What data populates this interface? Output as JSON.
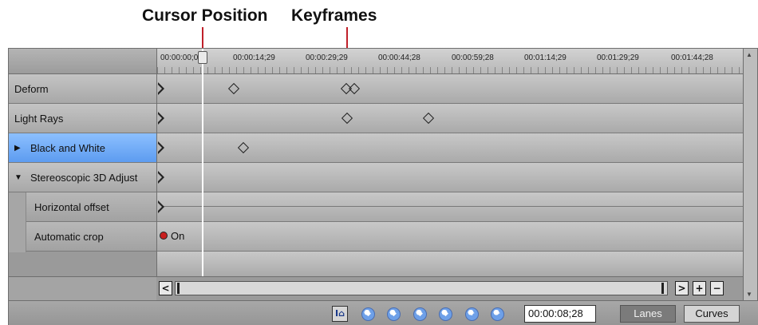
{
  "annotations": {
    "cursor_position": "Cursor Position",
    "keyframes": "Keyframes"
  },
  "ruler": {
    "labels": [
      "00:00:00;00",
      "00:00:14;29",
      "00:00:29;29",
      "00:00:44;28",
      "00:00:59;28",
      "00:01:14;29",
      "00:01:29;29",
      "00:01:44;28"
    ]
  },
  "tracks": [
    {
      "label": "Deform",
      "expander": "",
      "selected": false
    },
    {
      "label": "Light Rays",
      "expander": "",
      "selected": false
    },
    {
      "label": "Black and White",
      "expander": "▶",
      "selected": true
    },
    {
      "label": "Stereoscopic 3D Adjust",
      "expander": "▼",
      "selected": false
    }
  ],
  "subtracks": [
    {
      "label": "Horizontal offset"
    },
    {
      "label": "Automatic crop",
      "value": "On"
    }
  ],
  "scrollbar": {
    "left": "<",
    "right": ">",
    "zoom_in": "+",
    "zoom_out": "−"
  },
  "toolbar": {
    "sync_icon": "sync-cursor-icon",
    "time_value": "00:00:08;28",
    "lanes_label": "Lanes",
    "curves_label": "Curves",
    "active_view": "Lanes"
  },
  "colors": {
    "selected_track": "#5d9cf0",
    "annotation_line": "#c0202a",
    "cursor_line": "#ffffff"
  }
}
